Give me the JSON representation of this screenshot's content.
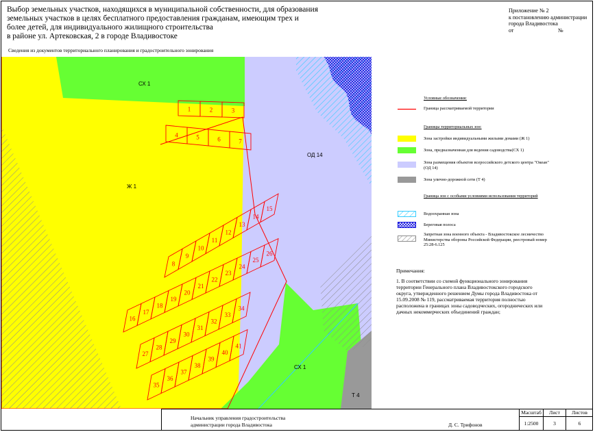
{
  "title": {
    "line1": "Выбор земельных участков, находящихся в муниципальной собственности, для образования",
    "line2": "земельных участков в целях бесплатного предоставления гражданам, имеющим трех и",
    "line3": "более детей, для индивидуального жилищного строительства",
    "line4": "в районе ул. Артековская, 2 в городе Владивостоке"
  },
  "appendix": {
    "line1": "Приложение № 2",
    "line2": "к постановлению администрации",
    "line3": "города Владивостока",
    "from_label": "от",
    "number_label": "№"
  },
  "subtitle": "Сведения из документов территориального планирования и градостроительного зонирования",
  "map": {
    "zone_labels": {
      "sx1_top": "СХ 1",
      "zh1": "Ж 1",
      "od14": "ОД 14",
      "sx1_bottom": "СХ 1",
      "t4": "Т 4"
    },
    "plots": [
      "1",
      "2",
      "3",
      "4",
      "5",
      "6",
      "7",
      "8",
      "9",
      "10",
      "11",
      "12",
      "13",
      "14",
      "15",
      "16",
      "17",
      "18",
      "19",
      "20",
      "21",
      "22",
      "23",
      "24",
      "25",
      "26",
      "27",
      "28",
      "29",
      "30",
      "31",
      "32",
      "33",
      "34",
      "35",
      "36",
      "37",
      "38",
      "39",
      "40",
      "41",
      "42",
      "43"
    ],
    "colors": {
      "zh1": "#ffff00",
      "sx1": "#66ff33",
      "od14": "#ccccff",
      "t4": "#999999",
      "boundary": "#ff0000",
      "water": "#33ccff",
      "shore": "#1111dd",
      "military": "#9a9a9a"
    }
  },
  "legend": {
    "heading": "Условные обозначения:",
    "boundary": "Граница рассматриваемой территории",
    "zones_heading": "Границы территориальных зон:",
    "zh1": "Зона застройки индивидуальными жилыми домами (Ж 1)",
    "sx1": "Зона, предназначенная для ведения садоводства(СХ 1)",
    "od14": "Зона размещения объектов всероссийского детского центра \"Океан\" (ОД 14)",
    "t4": "Зона улично-дорожной сети (Т 4)",
    "special_heading": "Граница зон с особыми условиями использования территорий",
    "water": "Водоохранная зона",
    "shore": "Береговая полоса",
    "military": "Запретная зона военного объекта - Владивостокское лесничество Министерства обороны Российской Федерации, реестровый номер 25:28-6.125"
  },
  "notes": {
    "heading": "Примечания:",
    "text": "1. В соответствии со схемой функционального зонирования территории Генерального плана Владивостокского городского округа, утвержденного решением Думы города Владивостока от 15.09.2008 № 119, рассматриваемая территория полностью расположена в границах зоны садоводческих, огороднических или дачных некоммерческих объединений граждан;"
  },
  "stamp": {
    "position_line1": "Начальник управления градостроительства",
    "position_line2": "администрации города Владивостока",
    "name": "Д. С. Трифонов",
    "scale_label": "Масштаб",
    "scale_value": "1:2500",
    "sheet_label": "Лист",
    "sheet_value": "3",
    "sheets_label": "Листов",
    "sheets_value": "6"
  }
}
